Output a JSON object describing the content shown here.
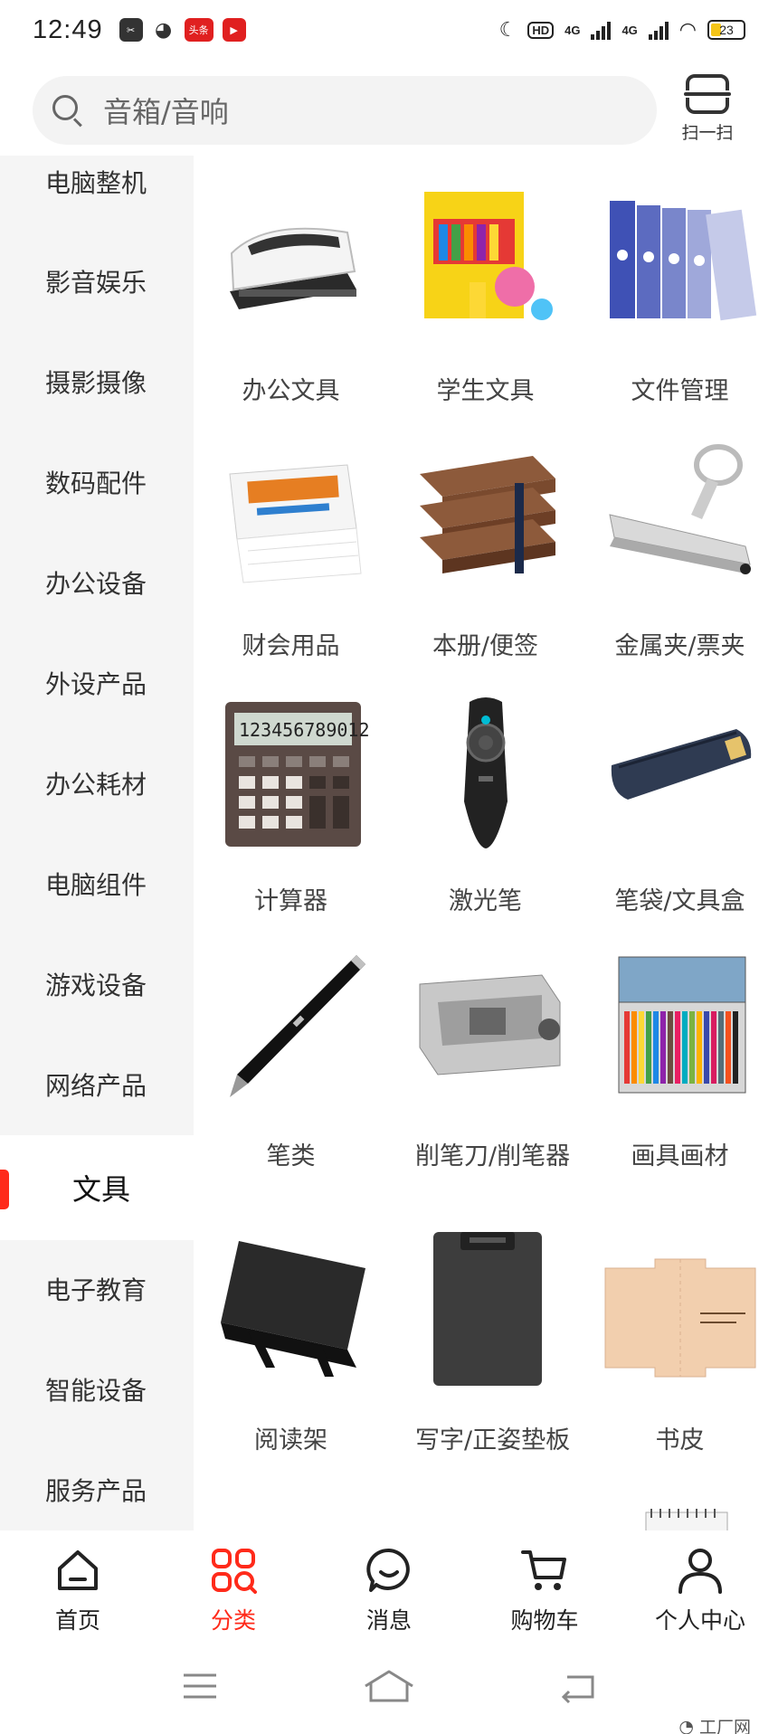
{
  "status_bar": {
    "time": "12:49",
    "battery": "23",
    "network_1": "4G",
    "network_2": "4G",
    "hd_badge": "HD",
    "notif_red_label": "头条"
  },
  "search": {
    "placeholder": "音箱/音响",
    "scan_label": "扫一扫"
  },
  "sidebar": {
    "items": [
      {
        "label": "电脑整机",
        "active": false
      },
      {
        "label": "影音娱乐",
        "active": false
      },
      {
        "label": "摄影摄像",
        "active": false
      },
      {
        "label": "数码配件",
        "active": false
      },
      {
        "label": "办公设备",
        "active": false
      },
      {
        "label": "外设产品",
        "active": false
      },
      {
        "label": "办公耗材",
        "active": false
      },
      {
        "label": "电脑组件",
        "active": false
      },
      {
        "label": "游戏设备",
        "active": false
      },
      {
        "label": "网络产品",
        "active": false
      },
      {
        "label": "文具",
        "active": true
      },
      {
        "label": "电子教育",
        "active": false
      },
      {
        "label": "智能设备",
        "active": false
      },
      {
        "label": "服务产品",
        "active": false
      }
    ]
  },
  "categories": [
    {
      "label": "办公文具",
      "icon": "stapler-icon"
    },
    {
      "label": "学生文具",
      "icon": "student-kit-icon"
    },
    {
      "label": "文件管理",
      "icon": "binders-icon"
    },
    {
      "label": "财会用品",
      "icon": "receipt-paper-icon"
    },
    {
      "label": "本册/便签",
      "icon": "notebooks-icon"
    },
    {
      "label": "金属夹/票夹",
      "icon": "clip-icon"
    },
    {
      "label": "计算器",
      "icon": "calculator-icon"
    },
    {
      "label": "激光笔",
      "icon": "laser-pointer-icon"
    },
    {
      "label": "笔袋/文具盒",
      "icon": "pencil-case-icon"
    },
    {
      "label": "笔类",
      "icon": "pen-icon"
    },
    {
      "label": "削笔刀/削笔器",
      "icon": "sharpener-icon"
    },
    {
      "label": "画具画材",
      "icon": "color-pencils-icon"
    },
    {
      "label": "阅读架",
      "icon": "book-stand-icon"
    },
    {
      "label": "写字/正姿垫板",
      "icon": "clipboard-icon"
    },
    {
      "label": "书皮",
      "icon": "book-cover-icon"
    }
  ],
  "calculator_display": "123456789012",
  "bottom_nav": {
    "items": [
      {
        "label": "首页",
        "icon": "home-icon"
      },
      {
        "label": "分类",
        "icon": "category-icon",
        "active": true
      },
      {
        "label": "消息",
        "icon": "message-icon"
      },
      {
        "label": "购物车",
        "icon": "cart-icon"
      },
      {
        "label": "个人中心",
        "icon": "user-icon"
      }
    ]
  },
  "watermark": "工厂网",
  "colors": {
    "accent": "#ff2a1a",
    "sidebar_bg": "#f5f5f5",
    "search_bg": "#f3f3f3"
  }
}
